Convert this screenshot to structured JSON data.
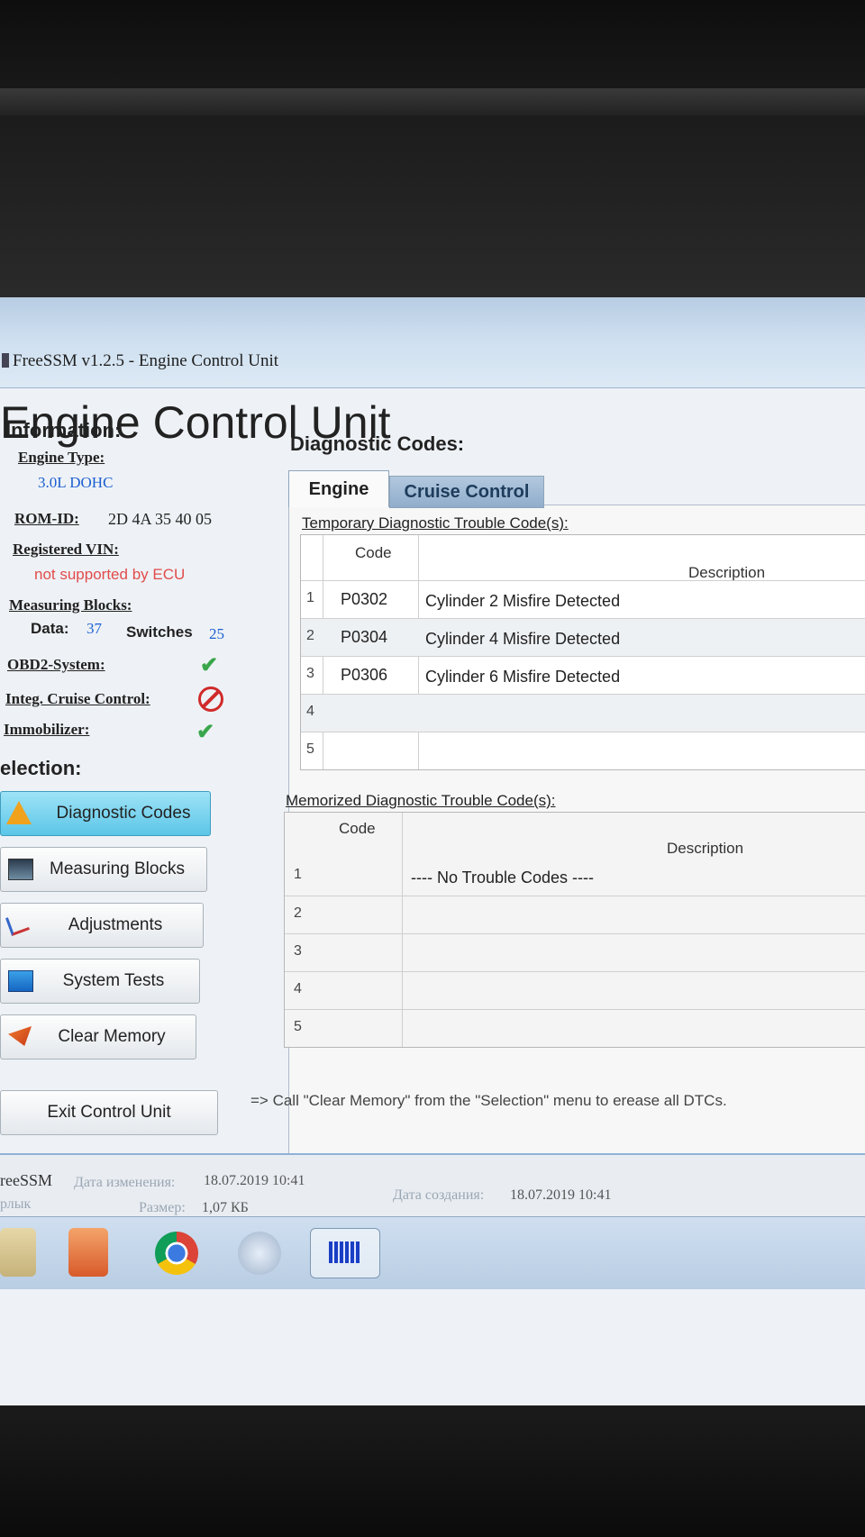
{
  "window": {
    "title": "FreeSSM v1.2.5 - Engine Control Unit"
  },
  "page": {
    "title": "Engine Control Unit"
  },
  "information": {
    "heading": "Information:",
    "engine_type_label": "Engine Type:",
    "engine_type_value": "3.0L DOHC",
    "rom_id_label": "ROM-ID:",
    "rom_id_value": "2D 4A 35 40 05",
    "vin_label": "Registered VIN:",
    "vin_value": "not supported by ECU",
    "measuring_blocks_label": "Measuring Blocks:",
    "data_label": "Data:",
    "data_value": "37",
    "switches_label": "Switches",
    "switches_value": "25",
    "obd2_label": "OBD2-System:",
    "cruise_label": "Integ. Cruise Control:",
    "immobilizer_label": "Immobilizer:"
  },
  "selection": {
    "heading": "election:",
    "buttons": {
      "diagnostic_codes": "Diagnostic Codes",
      "measuring_blocks": "Measuring Blocks",
      "adjustments": "Adjustments",
      "system_tests": "System Tests",
      "clear_memory": "Clear Memory"
    },
    "exit": "Exit Control Unit"
  },
  "diagnostic": {
    "heading": "Diagnostic Codes:",
    "tabs": {
      "engine": "Engine",
      "cruise": "Cruise Control"
    },
    "temporary": {
      "label": "Temporary Diagnostic Trouble Code(s):",
      "col_code": "Code",
      "col_desc": "Description",
      "rows": [
        {
          "num": "1",
          "code": "P0302",
          "desc": "Cylinder 2 Misfire Detected"
        },
        {
          "num": "2",
          "code": "P0304",
          "desc": "Cylinder 4 Misfire Detected"
        },
        {
          "num": "3",
          "code": "P0306",
          "desc": "Cylinder 6 Misfire Detected"
        },
        {
          "num": "4",
          "code": "",
          "desc": ""
        },
        {
          "num": "5",
          "code": "",
          "desc": ""
        }
      ]
    },
    "memorized": {
      "label": "Memorized Diagnostic Trouble Code(s):",
      "col_code": "Code",
      "col_desc": "Description",
      "rows": [
        {
          "num": "1",
          "desc": "---- No Trouble Codes ----"
        },
        {
          "num": "2",
          "desc": ""
        },
        {
          "num": "3",
          "desc": ""
        },
        {
          "num": "4",
          "desc": ""
        },
        {
          "num": "5",
          "desc": ""
        }
      ]
    },
    "hint": "=> Call \"Clear Memory\" from the \"Selection\" menu to erease all DTCs."
  },
  "status": {
    "app_name": "reeSSM",
    "modified_label": "Дата изменения:",
    "modified_value": "18.07.2019 10:41",
    "created_label": "Дата создания:",
    "created_value": "18.07.2019 10:41",
    "type_label": "рлык",
    "size_label": "Размер:",
    "size_value": "1,07 КБ"
  },
  "colors": {
    "accent": "#1c5fd1",
    "error": "#e24b4b",
    "ok": "#3aa64c",
    "active_button": "#5cc6e8"
  },
  "icons": {
    "obd2": "check-icon",
    "cruise": "no-entry-icon",
    "immobilizer": "check-icon"
  }
}
